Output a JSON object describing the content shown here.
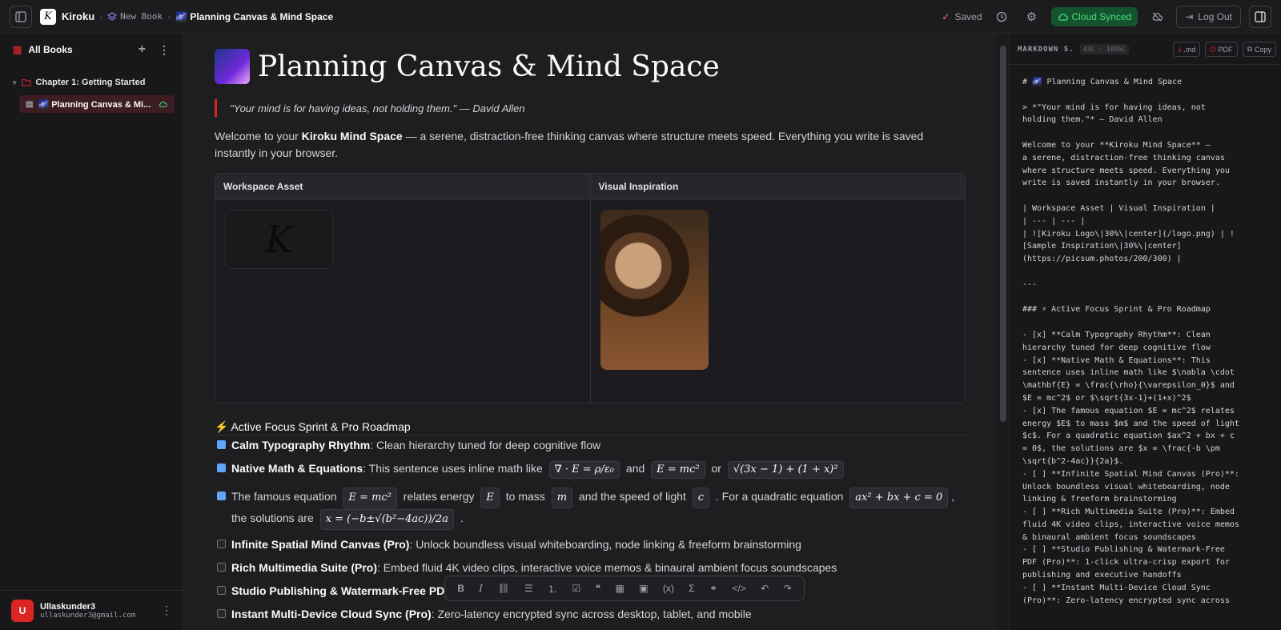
{
  "app": {
    "name": "Kiroku"
  },
  "breadcrumb": {
    "parent": "New Book",
    "current": "🌌 Planning Canvas & Mind Space"
  },
  "header": {
    "saved": "Saved",
    "synced": "Cloud Synced",
    "logout": "Log Out"
  },
  "sidebar": {
    "title": "All Books",
    "chapter": "Chapter 1: Getting Started",
    "page": "🌌 Planning Canvas & Mi..."
  },
  "user": {
    "name": "Ullaskunder3",
    "email": "ullaskunder3@gmail.com",
    "initial": "U"
  },
  "doc": {
    "title": "Planning Canvas & Mind Space",
    "quote": "\"Your mind is for having ideas, not holding them.\" — David Allen",
    "intro_pre": "Welcome to your ",
    "intro_bold": "Kiroku Mind Space",
    "intro_post": " — a serene, distraction-free thinking canvas where structure meets speed. Everything you write is saved instantly in your browser.",
    "table": {
      "col1": "Workspace Asset",
      "col2": "Visual Inspiration"
    },
    "roadmap_heading": "⚡ Active Focus Sprint & Pro Roadmap",
    "tasks": [
      {
        "bold": "Calm Typography Rhythm",
        "text": ": Clean hierarchy tuned for deep cognitive flow"
      },
      {
        "bold": "Native Math & Equations",
        "text": ": This sentence uses inline math like"
      },
      {
        "bold": "",
        "text": "The famous equation"
      },
      {
        "bold": "Infinite Spatial Mind Canvas (Pro)",
        "text": ": Unlock boundless visual whiteboarding, node linking & freeform brainstorming"
      },
      {
        "bold": "Rich Multimedia Suite (Pro)",
        "text": ": Embed fluid 4K video clips, interactive voice memos & binaural ambient focus soundscapes"
      },
      {
        "bold": "Studio Publishing & Watermark-Free PDF (",
        "text": ""
      },
      {
        "bold": "Instant Multi-Device Cloud Sync (Pro)",
        "text": ": Zero-latency encrypted sync across desktop, tablet, and mobile"
      }
    ],
    "math": {
      "m1": "∇ · E = ρ/ε₀",
      "and": "and",
      "m2": "E = mc²",
      "or": "or",
      "m3": "√(3x − 1) + (1 + x)²",
      "t2a": "relates energy",
      "m4": "E = mc²",
      "m5": "E",
      "t2b": "to mass",
      "m6": "m",
      "t2c": "and the speed of light",
      "m7": "c",
      "t2d": ". For a quadratic equation",
      "m8": "ax² + bx + c = 0",
      "t2e": ", the",
      "t2f": "solutions are",
      "m9": "x = (−b±√(b²−4ac))/2a",
      "t2g": "."
    }
  },
  "markdown": {
    "title": "MARKDOWN S...",
    "stats": "43L · 1895C",
    "btn_md": ".md",
    "btn_pdf": "PDF",
    "btn_copy": "Copy",
    "content": "# 🌌 Planning Canvas & Mind Space\n\n> *\"Your mind is for having ideas, not\nholding them.\"* — David Allen\n\nWelcome to your **Kiroku Mind Space** —\na serene, distraction-free thinking canvas\nwhere structure meets speed. Everything you\nwrite is saved instantly in your browser.\n\n| Workspace Asset | Visual Inspiration |\n| --- | --- |\n| ![Kiroku Logo\\|30%\\|center](/logo.png) | !\n[Sample Inspiration\\|30%\\|center]\n(https://picsum.photos/200/300) |\n\n---\n\n### ⚡ Active Focus Sprint & Pro Roadmap\n\n- [x] **Calm Typography Rhythm**: Clean\nhierarchy tuned for deep cognitive flow\n- [x] **Native Math & Equations**: This\nsentence uses inline math like $\\nabla \\cdot\n\\mathbf{E} = \\frac{\\rho}{\\varepsilon_0}$ and\n$E = mc^2$ or $\\sqrt{3x-1}+(1+x)^2$\n- [x] The famous equation $E = mc^2$ relates\nenergy $E$ to mass $m$ and the speed of light\n$c$. For a quadratic equation $ax^2 + bx + c\n= 0$, the solutions are $x = \\frac{-b \\pm\n\\sqrt{b^2-4ac}}{2a}$.\n- [ ] **Infinite Spatial Mind Canvas (Pro)**:\nUnlock boundless visual whiteboarding, node\nlinking & freeform brainstorming\n- [ ] **Rich Multimedia Suite (Pro)**: Embed\nfluid 4K video clips, interactive voice memos\n& binaural ambient focus soundscapes\n- [ ] **Studio Publishing & Watermark-Free\nPDF (Pro)**: 1-click ultra-crisp export for\npublishing and executive handoffs\n- [ ] **Instant Multi-Device Cloud Sync\n(Pro)**: Zero-latency encrypted sync across"
  },
  "toolbar_icons": [
    "bold-icon",
    "italic-icon",
    "link-icon",
    "bullet-list-icon",
    "numbered-list-icon",
    "task-list-icon",
    "quote-icon",
    "table-icon",
    "image-icon",
    "variable-icon",
    "sigma-icon",
    "diagram-icon",
    "code-icon",
    "undo-icon",
    "redo-icon"
  ],
  "colors": {
    "accent": "#dc2626",
    "synced_bg": "#14532d",
    "synced_fg": "#4ade80",
    "checkbox": "#60a5fa"
  }
}
